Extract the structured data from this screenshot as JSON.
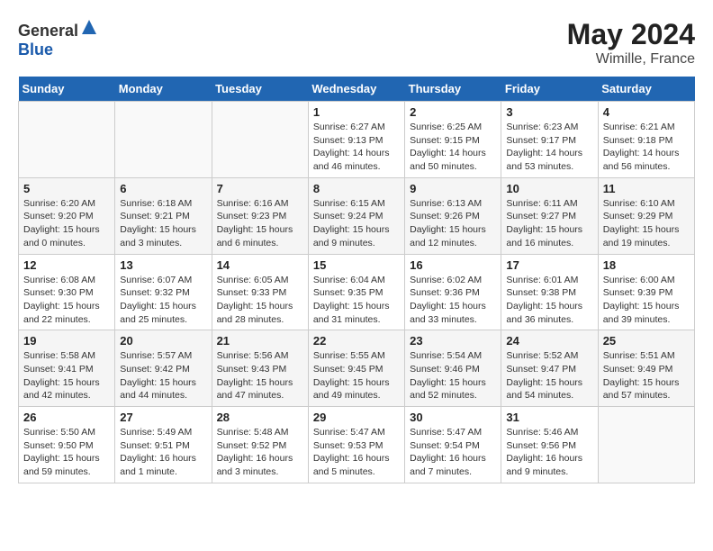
{
  "header": {
    "logo_general": "General",
    "logo_blue": "Blue",
    "month_year": "May 2024",
    "location": "Wimille, France"
  },
  "weekdays": [
    "Sunday",
    "Monday",
    "Tuesday",
    "Wednesday",
    "Thursday",
    "Friday",
    "Saturday"
  ],
  "weeks": [
    [
      {
        "day": "",
        "sunrise": "",
        "sunset": "",
        "daylight": ""
      },
      {
        "day": "",
        "sunrise": "",
        "sunset": "",
        "daylight": ""
      },
      {
        "day": "",
        "sunrise": "",
        "sunset": "",
        "daylight": ""
      },
      {
        "day": "1",
        "sunrise": "Sunrise: 6:27 AM",
        "sunset": "Sunset: 9:13 PM",
        "daylight": "Daylight: 14 hours and 46 minutes."
      },
      {
        "day": "2",
        "sunrise": "Sunrise: 6:25 AM",
        "sunset": "Sunset: 9:15 PM",
        "daylight": "Daylight: 14 hours and 50 minutes."
      },
      {
        "day": "3",
        "sunrise": "Sunrise: 6:23 AM",
        "sunset": "Sunset: 9:17 PM",
        "daylight": "Daylight: 14 hours and 53 minutes."
      },
      {
        "day": "4",
        "sunrise": "Sunrise: 6:21 AM",
        "sunset": "Sunset: 9:18 PM",
        "daylight": "Daylight: 14 hours and 56 minutes."
      }
    ],
    [
      {
        "day": "5",
        "sunrise": "Sunrise: 6:20 AM",
        "sunset": "Sunset: 9:20 PM",
        "daylight": "Daylight: 15 hours and 0 minutes."
      },
      {
        "day": "6",
        "sunrise": "Sunrise: 6:18 AM",
        "sunset": "Sunset: 9:21 PM",
        "daylight": "Daylight: 15 hours and 3 minutes."
      },
      {
        "day": "7",
        "sunrise": "Sunrise: 6:16 AM",
        "sunset": "Sunset: 9:23 PM",
        "daylight": "Daylight: 15 hours and 6 minutes."
      },
      {
        "day": "8",
        "sunrise": "Sunrise: 6:15 AM",
        "sunset": "Sunset: 9:24 PM",
        "daylight": "Daylight: 15 hours and 9 minutes."
      },
      {
        "day": "9",
        "sunrise": "Sunrise: 6:13 AM",
        "sunset": "Sunset: 9:26 PM",
        "daylight": "Daylight: 15 hours and 12 minutes."
      },
      {
        "day": "10",
        "sunrise": "Sunrise: 6:11 AM",
        "sunset": "Sunset: 9:27 PM",
        "daylight": "Daylight: 15 hours and 16 minutes."
      },
      {
        "day": "11",
        "sunrise": "Sunrise: 6:10 AM",
        "sunset": "Sunset: 9:29 PM",
        "daylight": "Daylight: 15 hours and 19 minutes."
      }
    ],
    [
      {
        "day": "12",
        "sunrise": "Sunrise: 6:08 AM",
        "sunset": "Sunset: 9:30 PM",
        "daylight": "Daylight: 15 hours and 22 minutes."
      },
      {
        "day": "13",
        "sunrise": "Sunrise: 6:07 AM",
        "sunset": "Sunset: 9:32 PM",
        "daylight": "Daylight: 15 hours and 25 minutes."
      },
      {
        "day": "14",
        "sunrise": "Sunrise: 6:05 AM",
        "sunset": "Sunset: 9:33 PM",
        "daylight": "Daylight: 15 hours and 28 minutes."
      },
      {
        "day": "15",
        "sunrise": "Sunrise: 6:04 AM",
        "sunset": "Sunset: 9:35 PM",
        "daylight": "Daylight: 15 hours and 31 minutes."
      },
      {
        "day": "16",
        "sunrise": "Sunrise: 6:02 AM",
        "sunset": "Sunset: 9:36 PM",
        "daylight": "Daylight: 15 hours and 33 minutes."
      },
      {
        "day": "17",
        "sunrise": "Sunrise: 6:01 AM",
        "sunset": "Sunset: 9:38 PM",
        "daylight": "Daylight: 15 hours and 36 minutes."
      },
      {
        "day": "18",
        "sunrise": "Sunrise: 6:00 AM",
        "sunset": "Sunset: 9:39 PM",
        "daylight": "Daylight: 15 hours and 39 minutes."
      }
    ],
    [
      {
        "day": "19",
        "sunrise": "Sunrise: 5:58 AM",
        "sunset": "Sunset: 9:41 PM",
        "daylight": "Daylight: 15 hours and 42 minutes."
      },
      {
        "day": "20",
        "sunrise": "Sunrise: 5:57 AM",
        "sunset": "Sunset: 9:42 PM",
        "daylight": "Daylight: 15 hours and 44 minutes."
      },
      {
        "day": "21",
        "sunrise": "Sunrise: 5:56 AM",
        "sunset": "Sunset: 9:43 PM",
        "daylight": "Daylight: 15 hours and 47 minutes."
      },
      {
        "day": "22",
        "sunrise": "Sunrise: 5:55 AM",
        "sunset": "Sunset: 9:45 PM",
        "daylight": "Daylight: 15 hours and 49 minutes."
      },
      {
        "day": "23",
        "sunrise": "Sunrise: 5:54 AM",
        "sunset": "Sunset: 9:46 PM",
        "daylight": "Daylight: 15 hours and 52 minutes."
      },
      {
        "day": "24",
        "sunrise": "Sunrise: 5:52 AM",
        "sunset": "Sunset: 9:47 PM",
        "daylight": "Daylight: 15 hours and 54 minutes."
      },
      {
        "day": "25",
        "sunrise": "Sunrise: 5:51 AM",
        "sunset": "Sunset: 9:49 PM",
        "daylight": "Daylight: 15 hours and 57 minutes."
      }
    ],
    [
      {
        "day": "26",
        "sunrise": "Sunrise: 5:50 AM",
        "sunset": "Sunset: 9:50 PM",
        "daylight": "Daylight: 15 hours and 59 minutes."
      },
      {
        "day": "27",
        "sunrise": "Sunrise: 5:49 AM",
        "sunset": "Sunset: 9:51 PM",
        "daylight": "Daylight: 16 hours and 1 minute."
      },
      {
        "day": "28",
        "sunrise": "Sunrise: 5:48 AM",
        "sunset": "Sunset: 9:52 PM",
        "daylight": "Daylight: 16 hours and 3 minutes."
      },
      {
        "day": "29",
        "sunrise": "Sunrise: 5:47 AM",
        "sunset": "Sunset: 9:53 PM",
        "daylight": "Daylight: 16 hours and 5 minutes."
      },
      {
        "day": "30",
        "sunrise": "Sunrise: 5:47 AM",
        "sunset": "Sunset: 9:54 PM",
        "daylight": "Daylight: 16 hours and 7 minutes."
      },
      {
        "day": "31",
        "sunrise": "Sunrise: 5:46 AM",
        "sunset": "Sunset: 9:56 PM",
        "daylight": "Daylight: 16 hours and 9 minutes."
      },
      {
        "day": "",
        "sunrise": "",
        "sunset": "",
        "daylight": ""
      }
    ]
  ]
}
